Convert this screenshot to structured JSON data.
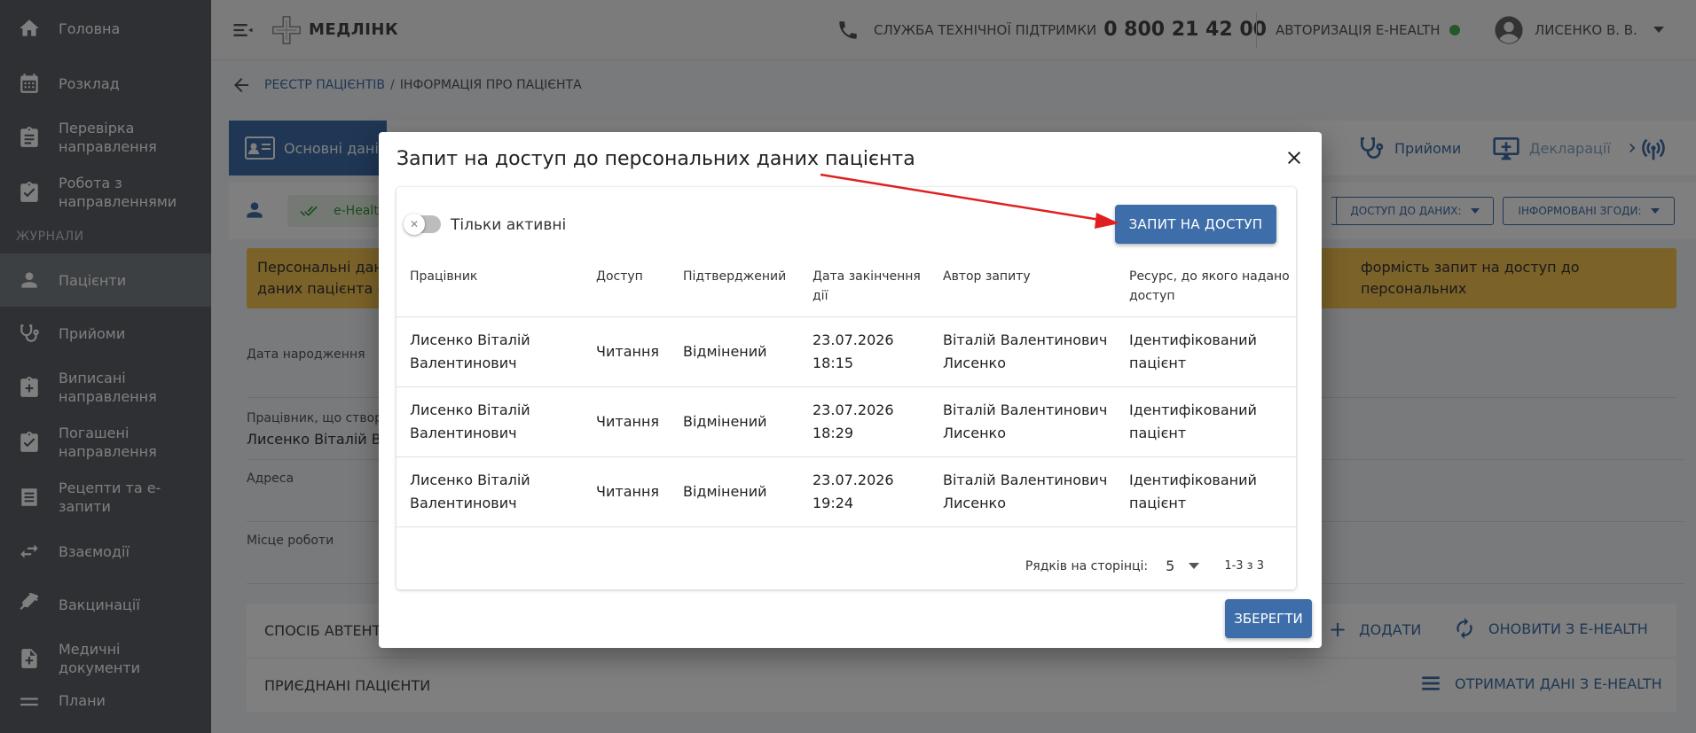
{
  "sidebar": {
    "items": [
      {
        "label": "Головна",
        "icon": "home-icon"
      },
      {
        "label": "Розклад",
        "icon": "calendar-icon"
      },
      {
        "label": "Перевірка направлення",
        "icon": "clipboard-icon"
      },
      {
        "label": "Робота з направленнями",
        "icon": "clipboard-check-icon"
      }
    ],
    "section_title": "ЖУРНАЛИ",
    "journal_items": [
      {
        "label": "Пацієнти",
        "icon": "person-icon",
        "active": true
      },
      {
        "label": "Прийоми",
        "icon": "stethoscope-icon"
      },
      {
        "label": "Виписані направлення",
        "icon": "clipboard-plus-icon"
      },
      {
        "label": "Погашені направлення",
        "icon": "clipboard-done-icon"
      },
      {
        "label": "Рецепти та е-запити",
        "icon": "list-icon"
      },
      {
        "label": "Взаємодії",
        "icon": "swap-icon"
      },
      {
        "label": "Вакцинації",
        "icon": "syringe-icon"
      },
      {
        "label": "Медичні документи",
        "icon": "document-plus-icon"
      },
      {
        "label": "Плани",
        "icon": "plan-icon"
      }
    ]
  },
  "header": {
    "logo_text": "МЕДЛІНК",
    "support_label": "СЛУЖБА ТЕХНІЧНОЇ ПІДТРИМКИ",
    "support_phone": "0 800 21 42 00",
    "auth_label": "АВТОРИЗАЦІЯ E-HEALTH",
    "user_name": "ЛИСЕНКО В. В."
  },
  "breadcrumb": {
    "link": "РЕЄСТР ПАЦІЄНТІВ",
    "separator": "/",
    "current": "ІНФОРМАЦІЯ ПРО ПАЦІЄНТА"
  },
  "background": {
    "tab_main": "Основні дані",
    "tab_partial": "і",
    "tab_receptions": "Прийоми",
    "tab_declarations": "Декларації",
    "ehealth_badge": "e-Healt",
    "btn_access_data": "ДОСТУП ДО ДАНИХ:",
    "btn_informed_consent": "ІНФОРМОВАНІ ЗГОДИ:",
    "warning_left_1": "Персональні дані",
    "warning_left_2": "даних пацієнта (м",
    "warning_right": "формість запит на доступ до персональних",
    "label_birthdate": "Дата народження",
    "label_creator": "Працівник, що створи",
    "value_creator": "Лисенко Віталій Ва",
    "label_address": "Адреса",
    "label_work": "Місце роботи",
    "section_auth": "СПОСІБ АВТЕНТИ",
    "action_add": "ДОДАТИ",
    "action_refresh": "ОНОВИТИ З E-HEALTH",
    "section_linked": "ПРИЄДНАНІ ПАЦІЄНТИ",
    "action_get_data": "ОТРИМАТИ ДАНІ З E-HEALTH"
  },
  "modal": {
    "title": "Запит на доступ до персональних даних пацієнта",
    "toggle_label": "Тільки активні",
    "request_button": "ЗАПИТ НА ДОСТУП",
    "columns": [
      "Працівник",
      "Доступ",
      "Підтверджений",
      "Дата закінчення дії",
      "Автор запиту",
      "Ресурс, до якого надано доступ"
    ],
    "rows": [
      {
        "employee": "Лисенко Віталій Валентинович",
        "access": "Читання",
        "confirmed": "Відмінений",
        "end_date": "23.07.2026",
        "end_time": "18:15",
        "author": "Віталій Валентинович Лисенко",
        "resource": "Ідентифікований пацієнт"
      },
      {
        "employee": "Лисенко Віталій Валентинович",
        "access": "Читання",
        "confirmed": "Відмінений",
        "end_date": "23.07.2026",
        "end_time": "18:29",
        "author": "Віталій Валентинович Лисенко",
        "resource": "Ідентифікований пацієнт"
      },
      {
        "employee": "Лисенко Віталій Валентинович",
        "access": "Читання",
        "confirmed": "Відмінений",
        "end_date": "23.07.2026",
        "end_time": "19:24",
        "author": "Віталій Валентинович Лисенко",
        "resource": "Ідентифікований пацієнт"
      }
    ],
    "rows_per_page_label": "Рядків на сторінці:",
    "rows_per_page": "5",
    "range": "1-3 з 3",
    "save_button": "ЗБЕРЕГТИ"
  },
  "colors": {
    "primary": "#3e6ea9",
    "sidebar": "#5d6166",
    "warning": "#f6c453",
    "arrow": "#e02020"
  }
}
